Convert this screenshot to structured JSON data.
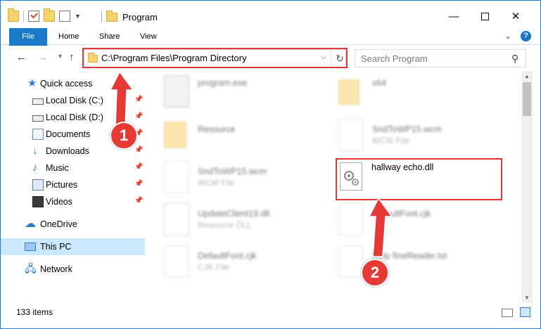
{
  "window": {
    "title": "Program",
    "controls": {
      "minimize": "—",
      "close": "✕"
    }
  },
  "ribbon": {
    "tabs": [
      "File",
      "Home",
      "Share",
      "View"
    ],
    "help": "?"
  },
  "navigation": {
    "back": "←",
    "forward": "→",
    "up": "↑",
    "address": "C:\\Program Files\\Program Directory",
    "refresh": "↻",
    "search_placeholder": "Search Program"
  },
  "sidebar": {
    "items": [
      {
        "label": "Quick access",
        "icon": "star-icon"
      },
      {
        "label": "Local Disk (C:)",
        "icon": "disk-icon",
        "pinned": true
      },
      {
        "label": "Local Disk (D:)",
        "icon": "disk-icon",
        "pinned": true
      },
      {
        "label": "Documents",
        "icon": "documents-icon",
        "pinned": true
      },
      {
        "label": "Downloads",
        "icon": "download-icon",
        "pinned": true
      },
      {
        "label": "Music",
        "icon": "music-icon",
        "pinned": true
      },
      {
        "label": "Pictures",
        "icon": "pictures-icon",
        "pinned": true
      },
      {
        "label": "Videos",
        "icon": "videos-icon",
        "pinned": true
      },
      {
        "label": "OneDrive",
        "icon": "cloud-icon"
      },
      {
        "label": "This PC",
        "icon": "computer-icon",
        "selected": true
      },
      {
        "label": "Network",
        "icon": "network-icon"
      }
    ]
  },
  "files": [
    {
      "name": "program.exe",
      "type": ""
    },
    {
      "name": "x64",
      "type": ""
    },
    {
      "name": "Resource",
      "type": ""
    },
    {
      "name": "SndToWP15.wcm",
      "type": "WCM File"
    },
    {
      "name": "SndToWP15.wcm",
      "type": "WCM File"
    },
    {
      "name": "hallway echo.dll",
      "type": ""
    },
    {
      "name": "UpdateClient19.dll",
      "type": "Resource DLL"
    },
    {
      "name": "DefaultFont.cjk",
      "type": ""
    },
    {
      "name": "DefaultFont.cjk",
      "type": "CJK File"
    },
    {
      "name": "Help fineReader.txt",
      "type": ""
    }
  ],
  "status": {
    "count": "133 items"
  },
  "callouts": {
    "one": "1",
    "two": "2"
  },
  "colors": {
    "accent": "#1979ca",
    "highlight": "#e13a3a",
    "selected": "#cce8ff"
  }
}
